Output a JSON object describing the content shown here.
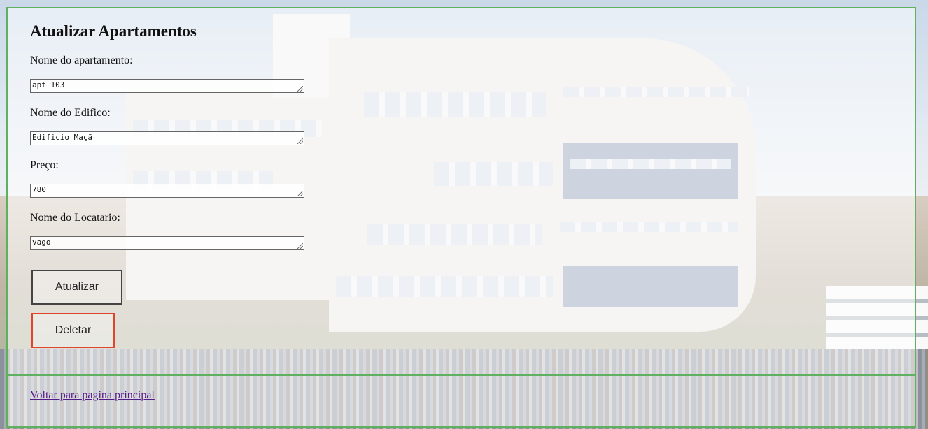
{
  "form": {
    "title": "Atualizar Apartamentos",
    "fields": [
      {
        "label": "Nome do apartamento:",
        "value": "apt 103"
      },
      {
        "label": "Nome do Edifico:",
        "value": "Edificio Maçã"
      },
      {
        "label": "Preço:",
        "value": "780"
      },
      {
        "label": "Nome do Locatario:",
        "value": "vago"
      }
    ],
    "update_label": "Atualizar",
    "delete_label": "Deletar"
  },
  "footer": {
    "back_link": "Voltar para pagina principal"
  },
  "colors": {
    "panel_border": "#5fb05f",
    "delete_border": "#e0452a",
    "link": "#551a8b"
  }
}
